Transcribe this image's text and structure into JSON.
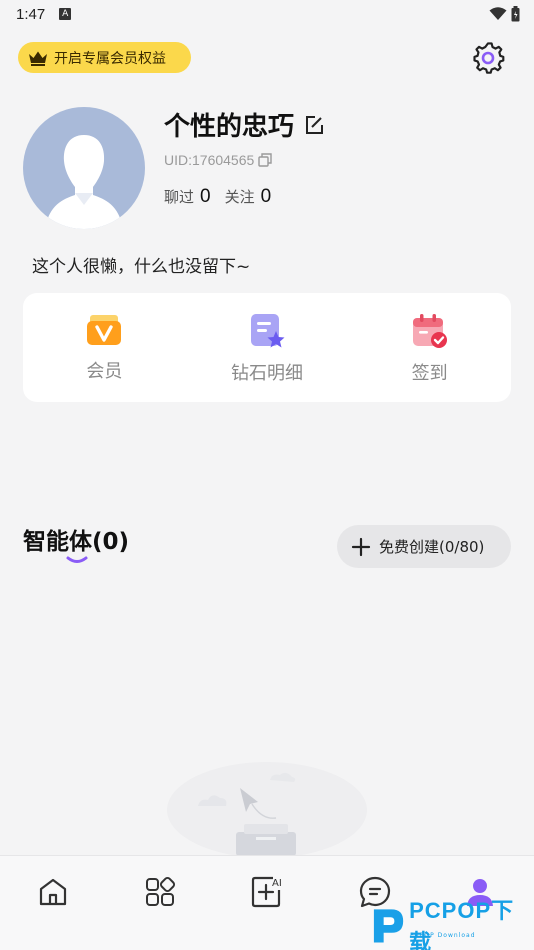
{
  "status_bar": {
    "time": "1:47"
  },
  "vip_banner": {
    "label": "开启专属会员权益"
  },
  "profile": {
    "nickname": "个性的忠巧",
    "uid": "UID:17604565",
    "stats": [
      {
        "label": "聊过",
        "value": "0"
      },
      {
        "label": "关注",
        "value": "0"
      }
    ],
    "bio": "这个人很懒，什么也没留下~"
  },
  "quick_actions": [
    {
      "label": "会员",
      "icon": "vip-icon"
    },
    {
      "label": "钻石明细",
      "icon": "diamond-detail-icon"
    },
    {
      "label": "签到",
      "icon": "checkin-calendar-icon"
    }
  ],
  "agents": {
    "title": "智能体(0)",
    "create_label": "免费创建(0/80)"
  },
  "bottom_nav": [
    {
      "name": "home",
      "icon": "home-icon",
      "active": false
    },
    {
      "name": "discover",
      "icon": "grid-icon",
      "active": false
    },
    {
      "name": "create",
      "icon": "ai-create-icon",
      "active": false
    },
    {
      "name": "messages",
      "icon": "chat-icon",
      "active": false
    },
    {
      "name": "profile",
      "icon": "user-icon",
      "active": true
    }
  ],
  "watermark": {
    "brand": "PCPOP下载",
    "sub": "PCPOP Download"
  },
  "colors": {
    "accent": "#8a5cf6",
    "vip_yellow": "#fbd84b",
    "background": "#f4f4f5"
  }
}
